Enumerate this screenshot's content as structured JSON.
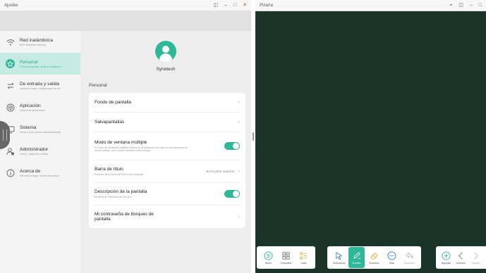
{
  "settings_window": {
    "title": "Ajustes",
    "controls": {
      "split": "◫",
      "minimize": "–",
      "maximize": "□",
      "close": "✕"
    }
  },
  "sidebar": {
    "items": [
      {
        "label": "Red inalámbrica",
        "sub": "Wi-Fi Bluetooth Ethernet",
        "icon": "wifi-icon",
        "active": false
      },
      {
        "label": "Personal",
        "sub": "Fondo de pantalla, modo de ventana m",
        "icon": "star-icon",
        "active": true
      },
      {
        "label": "De entrada y salida",
        "sub": "Salida de sonido, configuración de car",
        "icon": "swap-arrows-icon",
        "active": false
      },
      {
        "label": "Aplicación",
        "sub": "Gestión de aplicaciones",
        "icon": "app-cube-icon",
        "active": false
      },
      {
        "label": "Sistema",
        "sub": "Fecha y hora, idioma, almacenamiento",
        "icon": "monitor-icon",
        "active": false
      },
      {
        "label": "Administrador",
        "sub": "Control, seguridad, auditar",
        "icon": "user-admin-icon",
        "active": false
      },
      {
        "label": "Acerca de",
        "sub": "Información legal, versión de Android",
        "icon": "info-icon",
        "active": false
      }
    ]
  },
  "profile": {
    "name": "Synetech"
  },
  "personal": {
    "section_title": "Personal",
    "rows": [
      {
        "title": "Fondo de pantalla",
        "desc": "",
        "value": "",
        "control": "chevron"
      },
      {
        "title": "Salvapantallas",
        "desc": "",
        "value": "",
        "control": "chevron"
      },
      {
        "title": "Modo de ventana múltiple",
        "desc": "El modo de ventanas múltiples admite la visualización de más de una aplicación al mismo tiempo, pero puede consumir más energía",
        "value": "",
        "control": "toggle"
      },
      {
        "title": "Barra de título",
        "desc": "Posición de la barra de control de ventanas",
        "value": "En la parte superior",
        "control": "chevron"
      },
      {
        "title": "Descripción de la pantalla",
        "desc": "Muestra de instrucciones de uso",
        "value": "",
        "control": "toggle"
      },
      {
        "title": "Mi contraseña de bloqueo de pantalla",
        "desc": "",
        "value": "",
        "control": "chevron"
      }
    ]
  },
  "whiteboard_window": {
    "title": "Pizarra",
    "controls": {
      "pin": "⌖",
      "split": "◫",
      "minimize": "–",
      "maximize": "□"
    },
    "toolbar_groups": [
      [
        {
          "label": "Menú",
          "icon": "menu-circle-icon",
          "active": false,
          "disabled": false
        },
        {
          "label": "Compartir",
          "icon": "share-grid-icon",
          "active": false,
          "disabled": false
        },
        {
          "label": "Lista",
          "icon": "list-icon",
          "active": false,
          "disabled": false
        }
      ],
      [
        {
          "label": "Seleccione",
          "icon": "select-cursor-icon",
          "active": false,
          "disabled": false
        },
        {
          "label": "Escribir",
          "icon": "pen-icon",
          "active": true,
          "disabled": false
        },
        {
          "label": "Borrador",
          "icon": "eraser-icon",
          "active": false,
          "disabled": false
        },
        {
          "label": "Más",
          "icon": "more-icon",
          "active": false,
          "disabled": false
        },
        {
          "label": "Deshacer",
          "icon": "undo-icon",
          "active": false,
          "disabled": true
        }
      ],
      [
        {
          "label": "Agregar",
          "icon": "add-circle-icon",
          "active": false,
          "disabled": false
        },
        {
          "label": "Anterior",
          "icon": "chevron-left-icon",
          "active": false,
          "disabled": false
        },
        {
          "label": "Siguien",
          "icon": "chevron-right-icon",
          "active": false,
          "disabled": true
        }
      ]
    ]
  },
  "colors": {
    "accent": "#2fb898",
    "board": "#1b3429",
    "close": "#e0453a"
  }
}
